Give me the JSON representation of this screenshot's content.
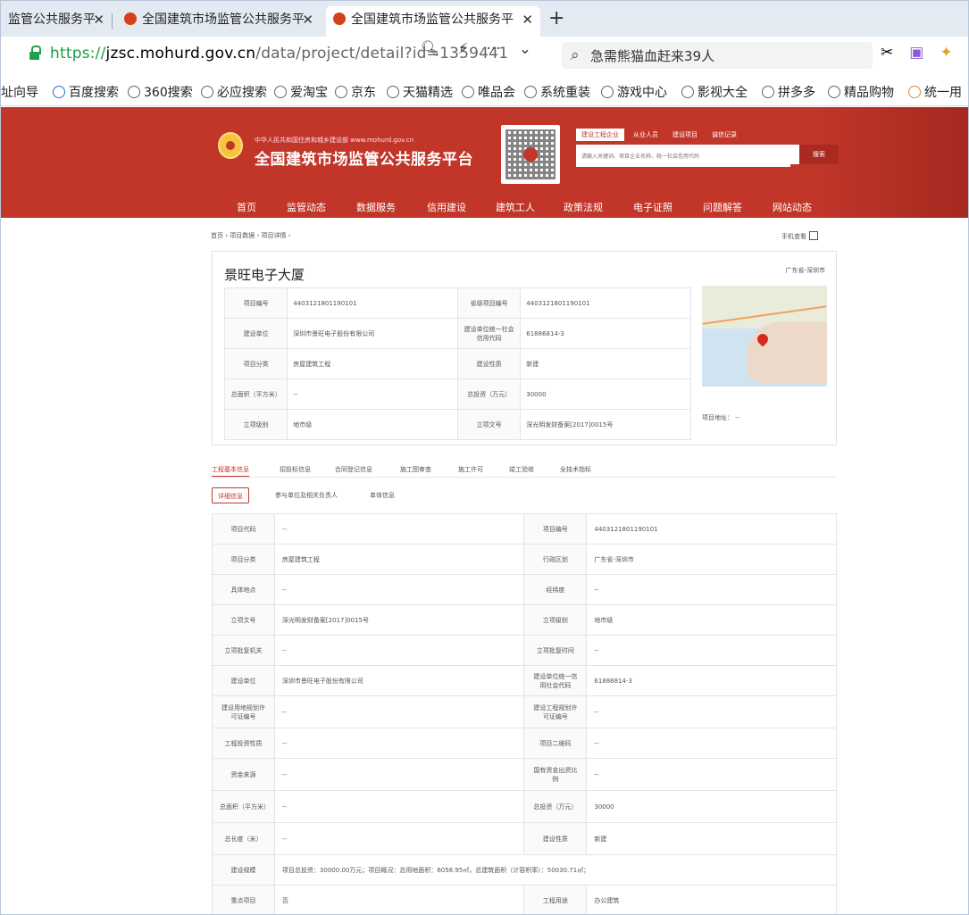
{
  "browser": {
    "tabs": [
      {
        "label": "监管公共服务平",
        "active": false
      },
      {
        "label": "全国建筑市场监管公共服务平",
        "active": false
      },
      {
        "label": "全国建筑市场监管公共服务平",
        "active": true
      }
    ],
    "new_tab": "+",
    "url": {
      "proto": "https://",
      "host": "jzsc.mohurd.gov.cn",
      "path": "/data/project/detail?id=1359441"
    },
    "search_text": "急需熊猫血赶来39人",
    "bookmarks": [
      "址向导",
      "百度搜索",
      "360搜索",
      "必应搜索",
      "爱淘宝",
      "京东",
      "天猫精选",
      "唯品会",
      "系统重装",
      "游戏中心",
      "影视大全",
      "拼多多",
      "精品购物",
      "统一用"
    ]
  },
  "site": {
    "ministry": "中华人民共和国住房和城乡建设部 www.mohurd.gov.cn",
    "title": "全国建筑市场监管公共服务平台",
    "search_tabs": [
      "建设工程企业",
      "从业人员",
      "建设项目",
      "诚信记录"
    ],
    "search_placeholder": "请输入关键词、项目企业名称、统一社会信用代码",
    "search_button": "搜索",
    "nav": [
      "首页",
      "监管动态",
      "数据服务",
      "信用建设",
      "建筑工人",
      "政策法规",
      "电子证照",
      "问题解答",
      "网站动态"
    ]
  },
  "breadcrumb": "首页 › 项目数据 › 项目详情 ›",
  "mobile_view": "手机查看",
  "project": {
    "name": "景旺电子大厦",
    "region": "广东省-深圳市",
    "summary": [
      [
        "项目编号",
        "4403121801190101",
        "省级项目编号",
        "4403121801190101"
      ],
      [
        "建设单位",
        "深圳市景旺电子股份有限公司",
        "建设单位统一社会信用代码",
        "61886814-3"
      ],
      [
        "项目分类",
        "房屋建筑工程",
        "建设性质",
        "新建"
      ],
      [
        "总面积（平方米）",
        "--",
        "总投资（万元）",
        "30000"
      ],
      [
        "立项级别",
        "地市级",
        "立项文号",
        "深光明发财备案[2017]0015号"
      ]
    ],
    "map_address": "项目地址： --"
  },
  "section_tabs": [
    "工程基本信息",
    "招投标信息",
    "合同登记信息",
    "施工图审查",
    "施工许可",
    "竣工验收",
    "全技术指标"
  ],
  "sub_tabs": [
    "详细信息",
    "参与单位及相关负责人",
    "单体信息"
  ],
  "detail": [
    [
      "项目代码",
      "--",
      "项目编号",
      "4403121801190101"
    ],
    [
      "项目分类",
      "房屋建筑工程",
      "行政区划",
      "广东省-深圳市"
    ],
    [
      "具体地点",
      "--",
      "经纬度",
      "--"
    ],
    [
      "立项文号",
      "深光明发财备案[2017]0015号",
      "立项级别",
      "地市级"
    ],
    [
      "立项批复机关",
      "--",
      "立项批复时间",
      "--"
    ],
    [
      "建设单位",
      "深圳市景旺电子股份有限公司",
      "建设单位统一信用社会代码",
      "61886814-3"
    ],
    [
      "建设用地规划许可证编号",
      "--",
      "建设工程规划许可证编号",
      "--"
    ],
    [
      "工程投资性质",
      "--",
      "项目二维码",
      "--"
    ],
    [
      "资金来源",
      "--",
      "国有资金出资比例",
      "--"
    ],
    [
      "总面积（平方米）",
      "--",
      "总投资（万元）",
      "30000"
    ],
    [
      "总长度（米）",
      "--",
      "建设性质",
      "新建"
    ],
    [
      "重点项目",
      "否",
      "工程用途",
      "办公建筑"
    ]
  ],
  "scale_label": "建设规模",
  "scale_text": "项目总投资：30000.00万元；项目概况：总用地面积：6058.95㎡，总建筑面积（计容积率）：50030.71㎡；"
}
